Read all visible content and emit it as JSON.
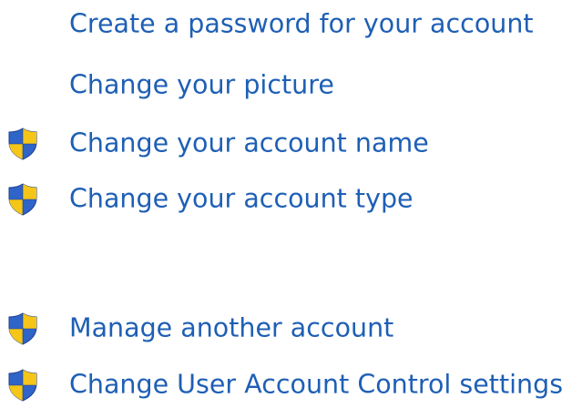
{
  "links": [
    {
      "label": "Create a password for your account",
      "shield": false
    },
    {
      "label": "Change your picture",
      "shield": false
    },
    {
      "label": "Change your account name",
      "shield": true
    },
    {
      "label": "Change your account type",
      "shield": true
    },
    {
      "label": "Manage another account",
      "shield": true
    },
    {
      "label": "Change User Account Control settings",
      "shield": true
    }
  ],
  "colors": {
    "link": "#1e5fb5",
    "shield_blue": "#2f64c9",
    "shield_yellow": "#f5c518"
  },
  "icons": {
    "shield": "uac-shield-icon"
  }
}
